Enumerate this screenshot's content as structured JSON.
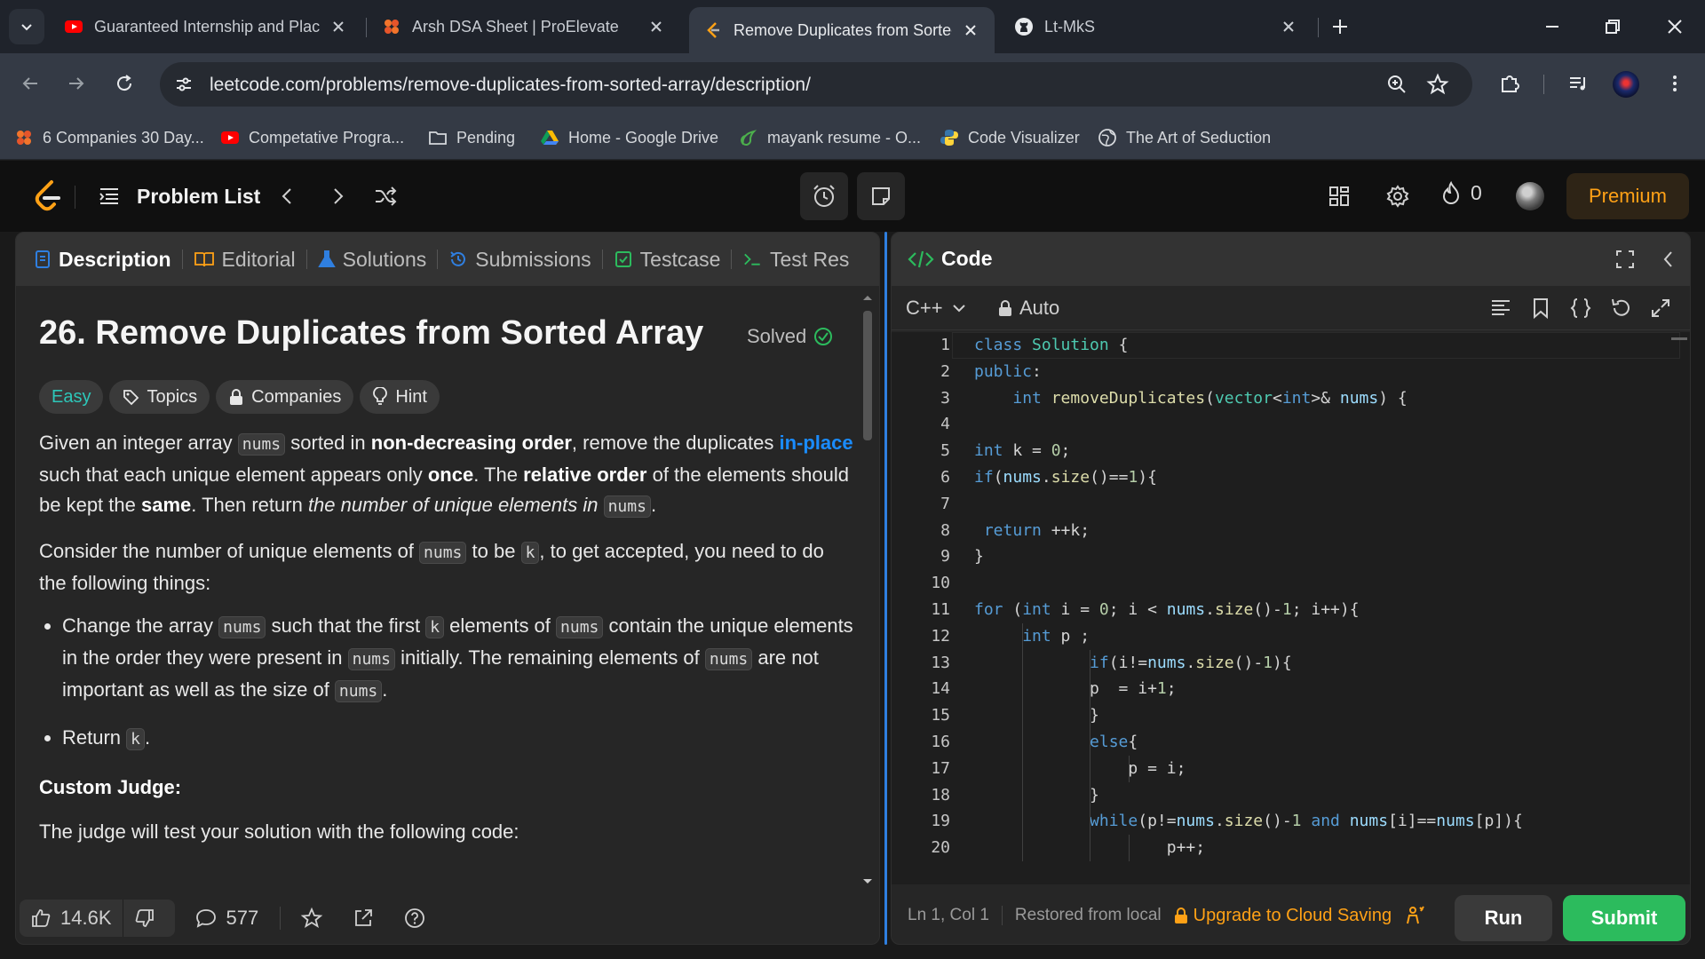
{
  "browser": {
    "tabs": [
      {
        "title": "Guaranteed Internship and Plac",
        "icon": "youtube-icon"
      },
      {
        "title": "Arsh DSA Sheet | ProElevate",
        "icon": "proelevate-icon"
      },
      {
        "title": "Remove Duplicates from Sorted",
        "icon": "leetcode-icon",
        "active": true
      },
      {
        "title": "Lt-MkS",
        "icon": "github-icon"
      }
    ],
    "url": "leetcode.com/problems/remove-duplicates-from-sorted-array/description/",
    "bookmarks": [
      {
        "label": "6 Companies 30 Day...",
        "icon": "proelevate-icon"
      },
      {
        "label": "Competative Progra...",
        "icon": "youtube-icon"
      },
      {
        "label": "Pending",
        "icon": "folder-icon"
      },
      {
        "label": "Home - Google Drive",
        "icon": "google-drive-icon"
      },
      {
        "label": "mayank resume - O...",
        "icon": "overleaf-icon"
      },
      {
        "label": "Code Visualizer",
        "icon": "python-icon"
      },
      {
        "label": "The Art of Seduction",
        "icon": "globe-icon"
      }
    ]
  },
  "nav": {
    "problem_list": "Problem List",
    "streak_count": "0",
    "premium": "Premium"
  },
  "left_tabs": [
    "Description",
    "Editorial",
    "Solutions",
    "Submissions",
    "Testcase",
    "Test Res"
  ],
  "problem": {
    "title": "26. Remove Duplicates from Sorted Array",
    "status": "Solved",
    "chips": [
      "Easy",
      "Topics",
      "Companies",
      "Hint"
    ],
    "para1": {
      "t1": "Given an integer array ",
      "c1": "nums",
      "t2": " sorted in ",
      "b1": "non-decreasing order",
      "t3": ", remove the duplicates ",
      "link": "in-place",
      "t4": " such that each unique element appears only ",
      "b2": "once",
      "t5": ". The ",
      "b3": "relative order",
      "t6": " of the elements should be kept the ",
      "b4": "same",
      "t7": ". Then return ",
      "i1": "the number of unique elements in ",
      "c2": "nums",
      "t8": "."
    },
    "para2": {
      "t1": "Consider the number of unique elements of ",
      "c1": "nums",
      "t2": " to be ",
      "c2": "k",
      "t3": ", to get accepted, you need to do the following things:"
    },
    "bullet1": {
      "t1": "Change the array ",
      "c1": "nums",
      "t2": " such that the first ",
      "c2": "k",
      "t3": " elements of ",
      "c3": "nums",
      "t4": " contain the unique elements in the order they were present in ",
      "c4": "nums",
      "t5": " initially. The remaining elements of ",
      "c5": "nums",
      "t6": " are not important as well as the size of ",
      "c6": "nums",
      "t7": "."
    },
    "bullet2": {
      "t1": "Return ",
      "c1": "k",
      "t2": "."
    },
    "custom_judge": "Custom Judge:",
    "judge_text": "The judge will test your solution with the following code:"
  },
  "footer": {
    "likes": "14.6K",
    "comments": "577"
  },
  "code_panel": {
    "title": "Code",
    "language": "C++",
    "mode": "Auto",
    "line_numbers": [
      "1",
      "2",
      "3",
      "4",
      "5",
      "6",
      "7",
      "8",
      "9",
      "10",
      "11",
      "12",
      "13",
      "14",
      "15",
      "16",
      "17",
      "18",
      "19",
      "20"
    ],
    "status_pos": "Ln 1, Col 1",
    "status_restore": "Restored from local",
    "upgrade": "Upgrade to Cloud Saving",
    "run": "Run",
    "submit": "Submit"
  },
  "code_lines": [
    [
      [
        "kw",
        "class"
      ],
      [
        "t",
        " "
      ],
      [
        "ty",
        "Solution"
      ],
      [
        "t",
        " {"
      ]
    ],
    [
      [
        "kw",
        "public"
      ],
      [
        "t",
        ":"
      ]
    ],
    [
      [
        "t",
        "    "
      ],
      [
        "kw",
        "int"
      ],
      [
        "t",
        " "
      ],
      [
        "fn",
        "removeDuplicates"
      ],
      [
        "t",
        "("
      ],
      [
        "ty",
        "vector"
      ],
      [
        "t",
        "<"
      ],
      [
        "kw",
        "int"
      ],
      [
        "t",
        ">& "
      ],
      [
        "vr",
        "nums"
      ],
      [
        "t",
        ") {"
      ]
    ],
    [],
    [
      [
        "kw",
        "int"
      ],
      [
        "t",
        " k = "
      ],
      [
        "nm",
        "0"
      ],
      [
        "t",
        ";"
      ]
    ],
    [
      [
        "kw",
        "if"
      ],
      [
        "t",
        "("
      ],
      [
        "vr",
        "nums"
      ],
      [
        "t",
        "."
      ],
      [
        "fn",
        "size"
      ],
      [
        "t",
        "()=="
      ],
      [
        "nm",
        "1"
      ],
      [
        "t",
        "){"
      ]
    ],
    [],
    [
      [
        "t",
        " "
      ],
      [
        "kw",
        "return"
      ],
      [
        "t",
        " ++k;"
      ]
    ],
    [
      [
        "t",
        "}"
      ]
    ],
    [],
    [
      [
        "kw",
        "for"
      ],
      [
        "t",
        " ("
      ],
      [
        "kw",
        "int"
      ],
      [
        "t",
        " i = "
      ],
      [
        "nm",
        "0"
      ],
      [
        "t",
        "; i < "
      ],
      [
        "vr",
        "nums"
      ],
      [
        "t",
        "."
      ],
      [
        "fn",
        "size"
      ],
      [
        "t",
        "()-"
      ],
      [
        "nm",
        "1"
      ],
      [
        "t",
        "; i++){"
      ]
    ],
    [
      [
        "t",
        "     "
      ],
      [
        "kw",
        "int"
      ],
      [
        "t",
        " p ;"
      ]
    ],
    [
      [
        "t",
        "            "
      ],
      [
        "kw",
        "if"
      ],
      [
        "t",
        "(i!="
      ],
      [
        "vr",
        "nums"
      ],
      [
        "t",
        "."
      ],
      [
        "fn",
        "size"
      ],
      [
        "t",
        "()-"
      ],
      [
        "nm",
        "1"
      ],
      [
        "t",
        "){"
      ]
    ],
    [
      [
        "t",
        "            p  = i+"
      ],
      [
        "nm",
        "1"
      ],
      [
        "t",
        ";"
      ]
    ],
    [
      [
        "t",
        "            }"
      ]
    ],
    [
      [
        "t",
        "            "
      ],
      [
        "kw",
        "else"
      ],
      [
        "t",
        "{"
      ]
    ],
    [
      [
        "t",
        "                p = i;"
      ]
    ],
    [
      [
        "t",
        "            }"
      ]
    ],
    [
      [
        "t",
        "            "
      ],
      [
        "kw",
        "while"
      ],
      [
        "t",
        "(p!="
      ],
      [
        "vr",
        "nums"
      ],
      [
        "t",
        "."
      ],
      [
        "fn",
        "size"
      ],
      [
        "t",
        "()-"
      ],
      [
        "nm",
        "1"
      ],
      [
        "t",
        " "
      ],
      [
        "kw",
        "and"
      ],
      [
        "t",
        " "
      ],
      [
        "vr",
        "nums"
      ],
      [
        "t",
        "[i]=="
      ],
      [
        "vr",
        "nums"
      ],
      [
        "t",
        "[p]){"
      ]
    ],
    [
      [
        "t",
        "                    p++;"
      ]
    ]
  ]
}
